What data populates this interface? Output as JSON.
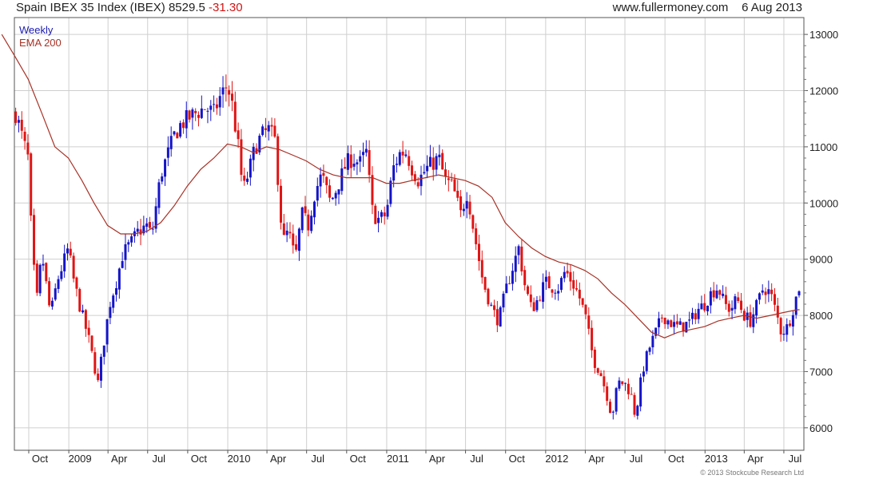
{
  "header": {
    "title": "Spain IBEX 35 Index (IBEX)",
    "last": "8529.5",
    "change": "-31.30",
    "site": "www.fullermoney.com",
    "date": "6 Aug 2013"
  },
  "copyright": "© 2013 Stockcube Research Ltd",
  "colors": {
    "up": "#1414c8",
    "down": "#e01414",
    "ema": "#a83226",
    "grid": "#cfcfcf"
  },
  "chart_data": {
    "type": "candlestick",
    "title": "Spain IBEX 35 Index (IBEX)",
    "period": "Weekly",
    "ylim": [
      5600,
      13300
    ],
    "y_ticks": [
      6000,
      7000,
      8000,
      9000,
      10000,
      11000,
      12000,
      13000
    ],
    "x_ticks": [
      "Oct",
      "2009",
      "Apr",
      "Jul",
      "Oct",
      "2010",
      "Apr",
      "Jul",
      "Oct",
      "2011",
      "Apr",
      "Jul",
      "Oct",
      "2012",
      "Apr",
      "Jul",
      "Oct",
      "2013",
      "Apr",
      "Jul"
    ],
    "grid": true,
    "legend": "top-left",
    "series": [
      {
        "name": "Weekly",
        "kind": "price",
        "points": [
          [
            "2008-09-01",
            11600
          ],
          [
            "2008-09-15",
            11200
          ],
          [
            "2008-09-29",
            10800
          ],
          [
            "2008-10-10",
            9000
          ],
          [
            "2008-10-20",
            8300
          ],
          [
            "2008-10-31",
            9100
          ],
          [
            "2008-11-20",
            8000
          ],
          [
            "2008-12-05",
            8600
          ],
          [
            "2008-12-31",
            9200
          ],
          [
            "2009-01-10",
            8700
          ],
          [
            "2009-01-25",
            8200
          ],
          [
            "2009-02-15",
            7600
          ],
          [
            "2009-03-09",
            6800
          ],
          [
            "2009-03-20",
            7400
          ],
          [
            "2009-04-05",
            8200
          ],
          [
            "2009-04-20",
            8600
          ],
          [
            "2009-05-05",
            9100
          ],
          [
            "2009-05-25",
            9300
          ],
          [
            "2009-06-10",
            9500
          ],
          [
            "2009-06-30",
            9600
          ],
          [
            "2009-07-10",
            9400
          ],
          [
            "2009-07-31",
            10500
          ],
          [
            "2009-08-31",
            11200
          ],
          [
            "2009-09-15",
            11400
          ],
          [
            "2009-10-01",
            11500
          ],
          [
            "2009-10-20",
            11600
          ],
          [
            "2009-11-10",
            11700
          ],
          [
            "2009-11-30",
            11600
          ],
          [
            "2009-12-15",
            11900
          ],
          [
            "2009-12-31",
            12100
          ],
          [
            "2010-01-10",
            11800
          ],
          [
            "2010-01-25",
            11000
          ],
          [
            "2010-02-05",
            10200
          ],
          [
            "2010-02-20",
            10600
          ],
          [
            "2010-03-05",
            11000
          ],
          [
            "2010-03-20",
            11200
          ],
          [
            "2010-04-05",
            11300
          ],
          [
            "2010-04-20",
            11100
          ],
          [
            "2010-05-07",
            9300
          ],
          [
            "2010-05-20",
            9500
          ],
          [
            "2010-06-05",
            9000
          ],
          [
            "2010-06-20",
            9800
          ],
          [
            "2010-07-05",
            9600
          ],
          [
            "2010-07-20",
            10200
          ],
          [
            "2010-08-05",
            10500
          ],
          [
            "2010-08-25",
            10000
          ],
          [
            "2010-09-10",
            10300
          ],
          [
            "2010-09-30",
            10700
          ],
          [
            "2010-10-15",
            10800
          ],
          [
            "2010-10-31",
            10700
          ],
          [
            "2010-11-15",
            10900
          ],
          [
            "2010-11-30",
            9800
          ],
          [
            "2010-12-15",
            9700
          ],
          [
            "2010-12-31",
            9800
          ],
          [
            "2011-01-15",
            10600
          ],
          [
            "2011-02-01",
            10900
          ],
          [
            "2011-02-15",
            10900
          ],
          [
            "2011-03-01",
            10600
          ],
          [
            "2011-03-15",
            10400
          ],
          [
            "2011-04-01",
            10600
          ],
          [
            "2011-04-15",
            10700
          ],
          [
            "2011-05-01",
            10800
          ],
          [
            "2011-05-15",
            10400
          ],
          [
            "2011-06-01",
            10300
          ],
          [
            "2011-06-20",
            9800
          ],
          [
            "2011-07-05",
            10200
          ],
          [
            "2011-07-20",
            9500
          ],
          [
            "2011-08-10",
            8600
          ],
          [
            "2011-08-31",
            8100
          ],
          [
            "2011-09-15",
            7900
          ],
          [
            "2011-09-30",
            8400
          ],
          [
            "2011-10-15",
            8800
          ],
          [
            "2011-10-31",
            9200
          ],
          [
            "2011-11-15",
            8500
          ],
          [
            "2011-11-30",
            8100
          ],
          [
            "2011-12-15",
            8300
          ],
          [
            "2011-12-31",
            8600
          ],
          [
            "2012-01-15",
            8500
          ],
          [
            "2012-01-31",
            8500
          ],
          [
            "2012-02-15",
            8800
          ],
          [
            "2012-03-01",
            8600
          ],
          [
            "2012-03-15",
            8400
          ],
          [
            "2012-04-01",
            8000
          ],
          [
            "2012-04-20",
            7200
          ],
          [
            "2012-05-05",
            7000
          ],
          [
            "2012-05-20",
            6600
          ],
          [
            "2012-06-01",
            6200
          ],
          [
            "2012-06-15",
            6800
          ],
          [
            "2012-06-30",
            6800
          ],
          [
            "2012-07-15",
            6600
          ],
          [
            "2012-07-25",
            6200
          ],
          [
            "2012-08-10",
            7000
          ],
          [
            "2012-08-25",
            7400
          ],
          [
            "2012-09-10",
            7700
          ],
          [
            "2012-09-25",
            8000
          ],
          [
            "2012-10-10",
            7900
          ],
          [
            "2012-10-25",
            7800
          ],
          [
            "2012-11-10",
            7800
          ],
          [
            "2012-11-30",
            7900
          ],
          [
            "2012-12-15",
            8100
          ],
          [
            "2012-12-31",
            8200
          ],
          [
            "2013-01-15",
            8400
          ],
          [
            "2013-01-31",
            8500
          ],
          [
            "2013-02-15",
            8200
          ],
          [
            "2013-02-28",
            8100
          ],
          [
            "2013-03-15",
            8300
          ],
          [
            "2013-04-01",
            8000
          ],
          [
            "2013-04-15",
            7900
          ],
          [
            "2013-05-01",
            8200
          ],
          [
            "2013-05-15",
            8500
          ],
          [
            "2013-05-31",
            8400
          ],
          [
            "2013-06-15",
            8000
          ],
          [
            "2013-06-25",
            7700
          ],
          [
            "2013-07-10",
            7800
          ],
          [
            "2013-07-25",
            8200
          ],
          [
            "2013-08-06",
            8530
          ]
        ]
      },
      {
        "name": "EMA 200",
        "kind": "ema",
        "points": [
          [
            "2008-07-31",
            13000
          ],
          [
            "2008-08-31",
            12600
          ],
          [
            "2008-09-30",
            12200
          ],
          [
            "2008-10-31",
            11600
          ],
          [
            "2008-11-30",
            11000
          ],
          [
            "2008-12-31",
            10800
          ],
          [
            "2009-01-31",
            10400
          ],
          [
            "2009-02-28",
            10000
          ],
          [
            "2009-03-31",
            9600
          ],
          [
            "2009-04-30",
            9450
          ],
          [
            "2009-05-31",
            9450
          ],
          [
            "2009-06-30",
            9500
          ],
          [
            "2009-07-31",
            9650
          ],
          [
            "2009-08-31",
            9950
          ],
          [
            "2009-09-30",
            10300
          ],
          [
            "2009-10-31",
            10600
          ],
          [
            "2009-11-30",
            10800
          ],
          [
            "2009-12-31",
            11050
          ],
          [
            "2010-01-31",
            11000
          ],
          [
            "2010-02-28",
            10900
          ],
          [
            "2010-03-31",
            11000
          ],
          [
            "2010-04-30",
            10950
          ],
          [
            "2010-05-31",
            10850
          ],
          [
            "2010-06-30",
            10750
          ],
          [
            "2010-07-31",
            10600
          ],
          [
            "2010-08-31",
            10500
          ],
          [
            "2010-09-30",
            10450
          ],
          [
            "2010-10-31",
            10450
          ],
          [
            "2010-11-30",
            10450
          ],
          [
            "2010-12-31",
            10350
          ],
          [
            "2011-01-31",
            10350
          ],
          [
            "2011-02-28",
            10400
          ],
          [
            "2011-03-31",
            10450
          ],
          [
            "2011-04-30",
            10500
          ],
          [
            "2011-05-31",
            10450
          ],
          [
            "2011-06-30",
            10400
          ],
          [
            "2011-07-31",
            10300
          ],
          [
            "2011-08-31",
            10100
          ],
          [
            "2011-09-30",
            9650
          ],
          [
            "2011-10-31",
            9400
          ],
          [
            "2011-11-30",
            9200
          ],
          [
            "2011-12-31",
            9050
          ],
          [
            "2012-01-31",
            8950
          ],
          [
            "2012-02-29",
            8900
          ],
          [
            "2012-03-31",
            8800
          ],
          [
            "2012-04-30",
            8650
          ],
          [
            "2012-05-31",
            8400
          ],
          [
            "2012-06-30",
            8200
          ],
          [
            "2012-07-31",
            7950
          ],
          [
            "2012-08-31",
            7700
          ],
          [
            "2012-09-30",
            7600
          ],
          [
            "2012-10-31",
            7700
          ],
          [
            "2012-11-30",
            7750
          ],
          [
            "2012-12-31",
            7800
          ],
          [
            "2013-01-31",
            7900
          ],
          [
            "2013-02-28",
            7950
          ],
          [
            "2013-03-31",
            8000
          ],
          [
            "2013-04-30",
            7950
          ],
          [
            "2013-05-31",
            8000
          ],
          [
            "2013-06-30",
            8050
          ],
          [
            "2013-07-31",
            8100
          ],
          [
            "2013-08-06",
            8100
          ]
        ]
      }
    ]
  }
}
